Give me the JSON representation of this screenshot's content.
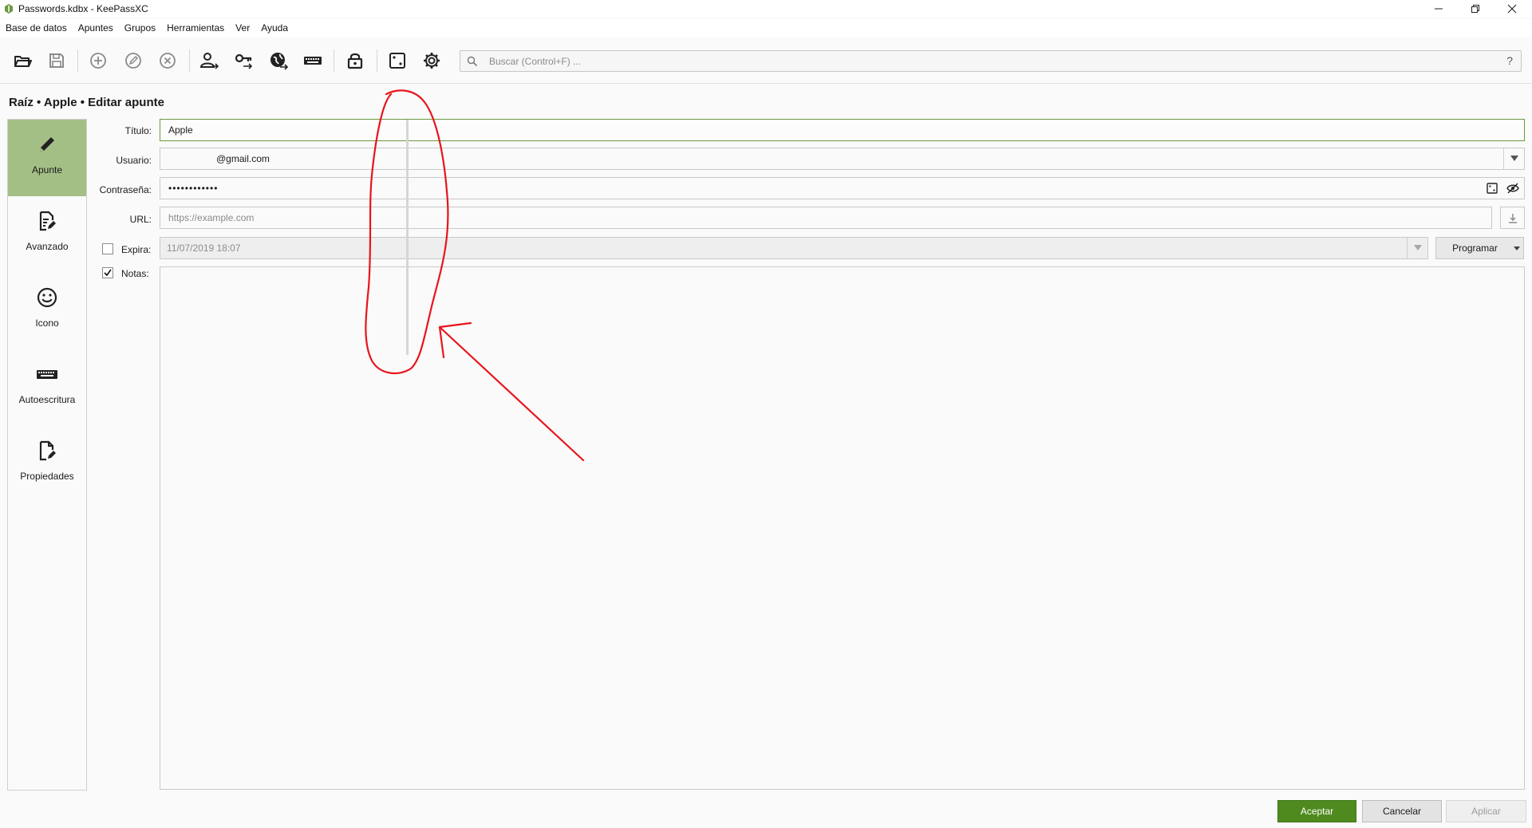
{
  "window": {
    "title": "Passwords.kdbx - KeePassXC",
    "logo_icon": "keepassxc-logo-icon"
  },
  "menu": {
    "items": [
      "Base de datos",
      "Apuntes",
      "Grupos",
      "Herramientas",
      "Ver",
      "Ayuda"
    ]
  },
  "toolbar": {
    "buttons": [
      "open-database-icon",
      "save-database-icon",
      "add-entry-icon",
      "edit-entry-icon",
      "delete-entry-icon",
      "copy-username-icon",
      "copy-password-icon",
      "copy-url-icon",
      "autotype-keyboard-icon",
      "lock-database-icon",
      "password-generator-dice-icon",
      "settings-gear-icon"
    ]
  },
  "search": {
    "placeholder": "Buscar (Control+F) ...",
    "help_glyph": "?"
  },
  "breadcrumb": {
    "text": "Raíz • Apple • Editar apunte"
  },
  "sidebar": {
    "items": [
      {
        "label": "Apunte",
        "icon": "pencil-icon",
        "active": true
      },
      {
        "label": "Avanzado",
        "icon": "document-edit-icon",
        "active": false
      },
      {
        "label": "Icono",
        "icon": "smiley-icon",
        "active": false
      },
      {
        "label": "Autoescritura",
        "icon": "keyboard-icon",
        "active": false
      },
      {
        "label": "Propiedades",
        "icon": "file-edit-icon",
        "active": false
      }
    ]
  },
  "form": {
    "title_label": "Título:",
    "title_value": "Apple",
    "username_label": "Usuario:",
    "username_value": "@gmail.com",
    "password_label": "Contraseña:",
    "password_value": "••••••••••••",
    "url_label": "URL:",
    "url_placeholder": "https://example.com",
    "expires_label": "Expira:",
    "expires_checked": false,
    "expires_value": "11/07/2019 18:07",
    "program_label": "Programar",
    "notes_label": "Notas:",
    "notes_checked": true,
    "notes_value": ""
  },
  "buttons": {
    "ok": "Aceptar",
    "cancel": "Cancelar",
    "apply": "Aplicar"
  },
  "colors": {
    "accent_green": "#4f8a1f",
    "sidebar_active": "#a4bf85",
    "annotation_red": "#e8141c"
  }
}
